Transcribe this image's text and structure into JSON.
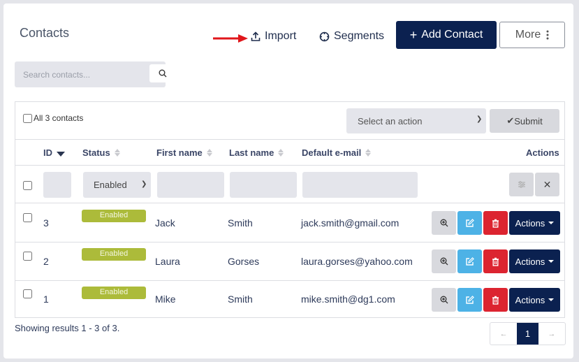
{
  "page": {
    "title": "Contacts"
  },
  "toolbar": {
    "import_label": "Import",
    "segments_label": "Segments",
    "add_contact_label": "Add Contact",
    "more_label": "More"
  },
  "search": {
    "placeholder": "Search contacts..."
  },
  "bulk": {
    "select_all_label": "All 3 contacts",
    "action_select_value": "Select an action",
    "submit_label": "Submit"
  },
  "table": {
    "columns": {
      "id": "ID",
      "status": "Status",
      "first_name": "First name",
      "last_name": "Last name",
      "email": "Default e-mail",
      "actions": "Actions"
    },
    "filter": {
      "status_value": "Enabled"
    },
    "rows": [
      {
        "id": "3",
        "status": "Enabled",
        "first_name": "Jack",
        "last_name": "Smith",
        "email": "jack.smith@gmail.com",
        "actions_label": "Actions"
      },
      {
        "id": "2",
        "status": "Enabled",
        "first_name": "Laura",
        "last_name": "Gorses",
        "email": "laura.gorses@yahoo.com",
        "actions_label": "Actions"
      },
      {
        "id": "1",
        "status": "Enabled",
        "first_name": "Mike",
        "last_name": "Smith",
        "email": "mike.smith@dg1.com",
        "actions_label": "Actions"
      }
    ]
  },
  "footer": {
    "results_text": "Showing results 1 - 3 of 3.",
    "pager": {
      "prev": "←",
      "current_page": "1",
      "next": "→"
    }
  },
  "colors": {
    "primary": "#0b2150",
    "status_enabled": "#acbb3a",
    "edit": "#4db2e6",
    "delete": "#dc2430",
    "annotation_arrow": "#e0161b"
  }
}
